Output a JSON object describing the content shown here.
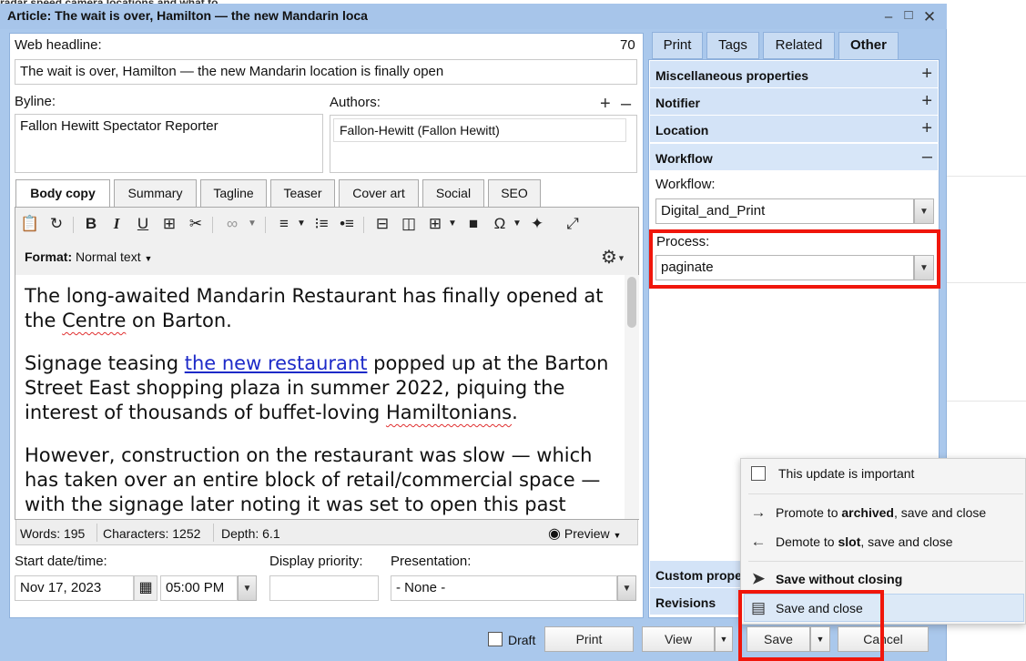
{
  "window": {
    "title": "Article: The wait is over, Hamilton — the new Mandarin loca",
    "bg_strip_text": "radar speed camera locations and what to"
  },
  "headline": {
    "label": "Web headline:",
    "count": "70",
    "value": "The wait is over, Hamilton — the new Mandarin location is finally open"
  },
  "byline": {
    "label": "Byline:",
    "value": "Fallon Hewitt Spectator Reporter"
  },
  "authors": {
    "label": "Authors:",
    "items": [
      "Fallon-Hewitt (Fallon Hewitt)"
    ]
  },
  "editor_tabs": [
    "Body copy",
    "Summary",
    "Tagline",
    "Teaser",
    "Cover art",
    "Social",
    "SEO"
  ],
  "toolbar": {
    "format_label": "Format:",
    "format_value": "Normal text"
  },
  "body": {
    "p1_a": "The long-awaited Mandarin Restaurant has finally opened at the ",
    "p1_b": "Centre",
    "p1_c": " on Barton.",
    "p2_a": "Signage teasing ",
    "p2_link": "the new restaurant",
    "p2_b": " popped up at the Barton Street East shopping plaza in summer 2022, piquing the interest of thousands of buffet-loving ",
    "p2_c": "Hamiltonians",
    "p2_d": ".",
    "p3": "However, construction on the restaurant was slow — which has taken over an entire block of retail/commercial space — with the signage later noting it was set to open this past"
  },
  "status": {
    "words": "Words: 195",
    "characters": "Characters: 1252",
    "depth": "Depth: 6.1",
    "preview": "Preview"
  },
  "schedule": {
    "start_label": "Start date/time:",
    "date": "Nov 17, 2023",
    "time": "05:00 PM",
    "priority_label": "Display priority:",
    "priority_value": "",
    "presentation_label": "Presentation:",
    "presentation_value": "- None -"
  },
  "right_tabs": [
    "Print",
    "Tags",
    "Related",
    "Other"
  ],
  "sections": {
    "misc": "Miscellaneous properties",
    "notifier": "Notifier",
    "location": "Location",
    "workflow": "Workflow",
    "custom": "Custom prope",
    "revisions": "Revisions"
  },
  "workflow": {
    "workflow_label": "Workflow:",
    "workflow_value": "Digital_and_Print",
    "process_label": "Process:",
    "process_value": "paginate"
  },
  "save_menu": {
    "important": "This update is important",
    "promote_a": "Promote to ",
    "promote_b": "archived",
    "promote_c": ", save and close",
    "demote_a": "Demote to ",
    "demote_b": "slot",
    "demote_c": ", save and close",
    "save_without": "Save without closing",
    "save_close": "Save and close"
  },
  "footer": {
    "draft": "Draft",
    "print": "Print",
    "view": "View",
    "save": "Save",
    "cancel": "Cancel"
  },
  "colors": {
    "window_chrome": "#aac8ec",
    "highlight_red": "#f0160b",
    "link": "#1d2ac8"
  }
}
